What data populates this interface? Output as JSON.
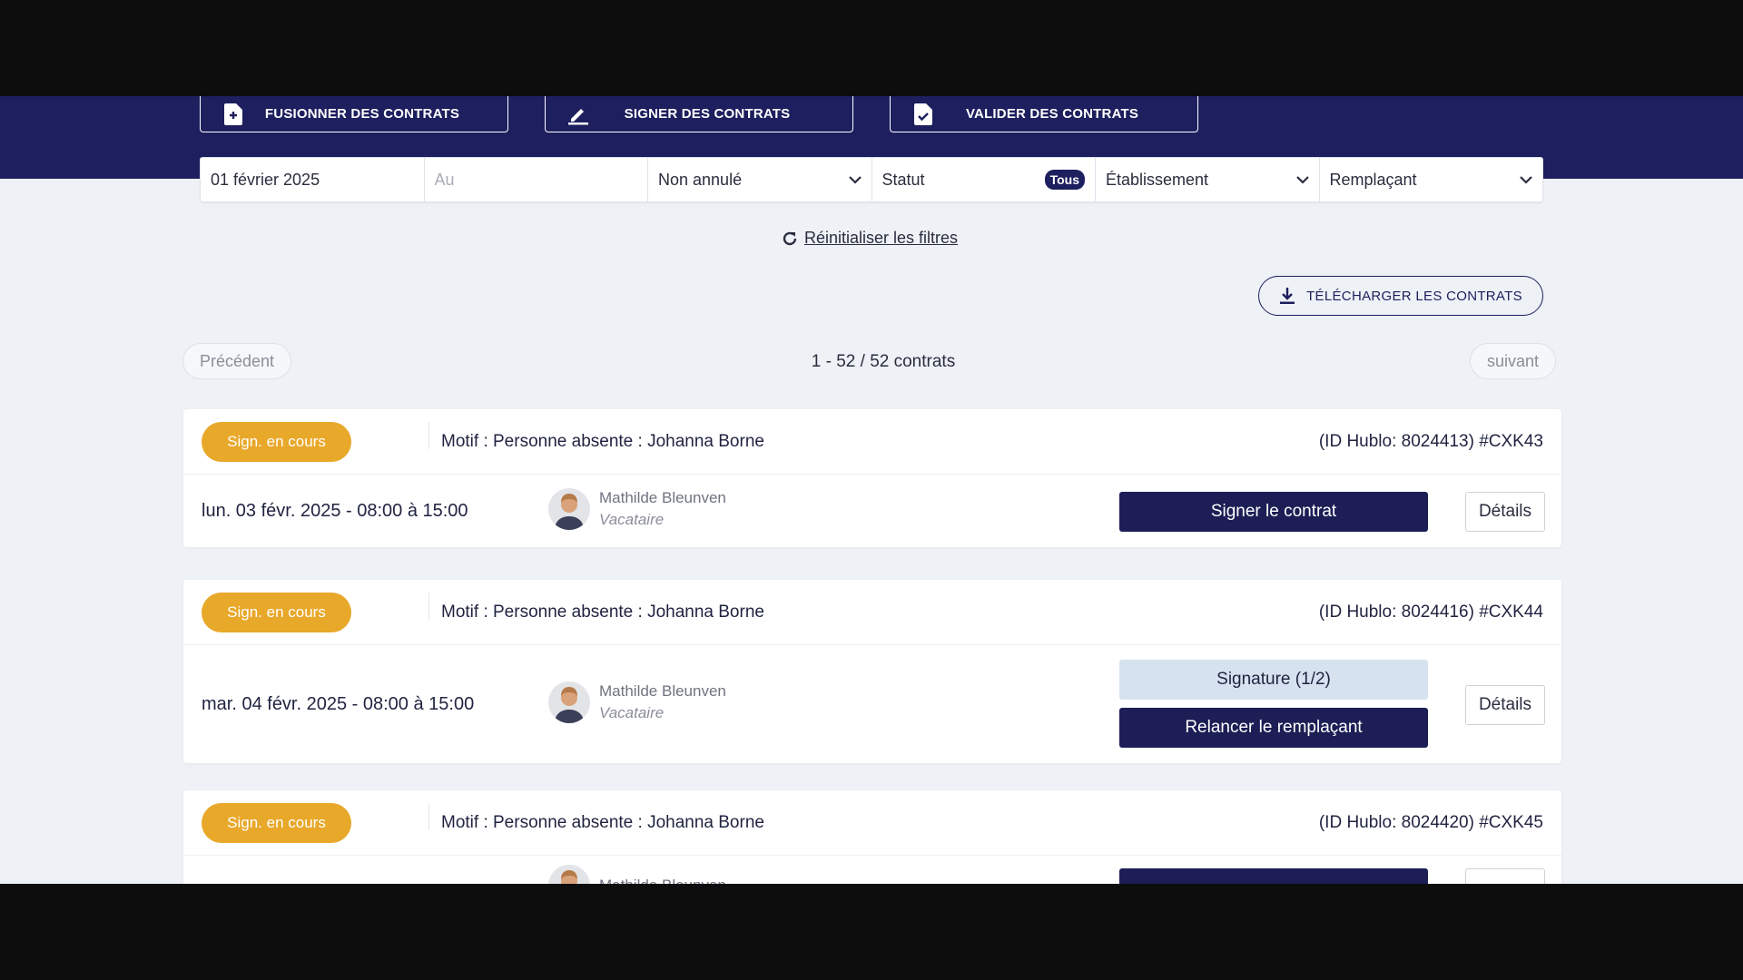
{
  "toolbar": {
    "merge_label": "FUSIONNER DES CONTRATS",
    "sign_label": "SIGNER DES CONTRATS",
    "validate_label": "VALIDER DES CONTRATS"
  },
  "filters": {
    "date_from": "01 février 2025",
    "date_to_placeholder": "Au",
    "cancel_status": "Non annulé",
    "statut_label": "Statut",
    "statut_value": "Tous",
    "etablissement": "Établissement",
    "remplacant": "Remplaçant"
  },
  "reset_label": "Réinitialiser les filtres",
  "download_label": "TÉLÉCHARGER LES CONTRATS",
  "pagination": {
    "prev": "Précédent",
    "next": "suivant",
    "count": "1 - 52 / 52 contrats"
  },
  "contracts": [
    {
      "status": "Sign. en cours",
      "motif": "Motif : Personne absente : Johanna Borne",
      "idref": "(ID Hublo: 8024413) #CXK43",
      "date": "lun. 03 févr. 2025 - 08:00 à 15:00",
      "person_name": "Mathilde Bleunven",
      "person_role": "Vacataire",
      "primary_action": "Signer le contrat",
      "details": "Détails"
    },
    {
      "status": "Sign. en cours",
      "motif": "Motif : Personne absente : Johanna Borne",
      "idref": "(ID Hublo: 8024416) #CXK44",
      "date": "mar. 04 févr. 2025 - 08:00 à 15:00",
      "person_name": "Mathilde Bleunven",
      "person_role": "Vacataire",
      "signature_status": "Signature (1/2)",
      "primary_action": "Relancer le remplaçant",
      "details": "Détails"
    },
    {
      "status": "Sign. en cours",
      "motif": "Motif : Personne absente : Johanna Borne",
      "idref": "(ID Hublo: 8024420) #CXK45",
      "person_name": "Mathilde Bleunven"
    }
  ]
}
